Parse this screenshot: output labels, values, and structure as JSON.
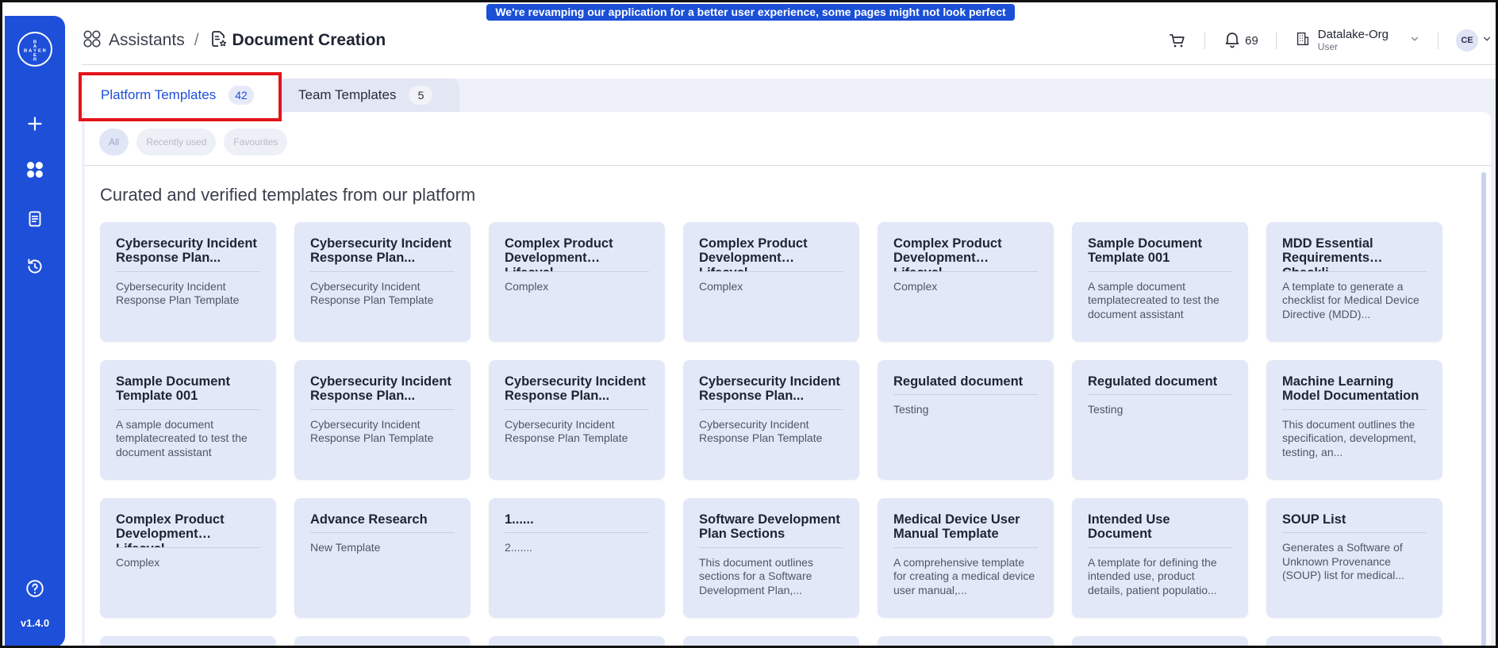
{
  "banner": {
    "text": "We're revamping our application for a better user experience, some pages might not look perfect yet!"
  },
  "sidebar": {
    "logo_text": "BAYER",
    "version": "v1.4.0"
  },
  "breadcrumb": {
    "root": "Assistants",
    "separator": "/",
    "current": "Document Creation"
  },
  "header": {
    "notification_count": "69",
    "org_name": "Datalake-Org",
    "org_role": "User",
    "avatar_initials": "CE"
  },
  "tabs": [
    {
      "label": "Platform Templates",
      "count": "42"
    },
    {
      "label": "Team Templates",
      "count": "5"
    }
  ],
  "filters": [
    "All",
    "Recently used",
    "Favourites"
  ],
  "section_title": "Curated and verified templates from our platform",
  "cards": [
    {
      "title": "Cybersecurity Incident Response Plan...",
      "desc": "Cybersecurity Incident Response Plan Template"
    },
    {
      "title": "Cybersecurity Incident Response Plan...",
      "desc": "Cybersecurity Incident Response Plan Template"
    },
    {
      "title": "Complex Product Development Lifecycl...",
      "desc": "Complex"
    },
    {
      "title": "Complex Product Development Lifecycl...",
      "desc": "Complex"
    },
    {
      "title": "Complex Product Development Lifecycl...",
      "desc": "Complex"
    },
    {
      "title": "Sample Document Template 001",
      "desc": "A sample document templatecreated to test the document assistant"
    },
    {
      "title": "MDD Essential Requirements Checkli...",
      "desc": "A template to generate a checklist for Medical Device Directive (MDD)..."
    },
    {
      "title": "Sample Document Template 001",
      "desc": "A sample document templatecreated to test the document assistant"
    },
    {
      "title": "Cybersecurity Incident Response Plan...",
      "desc": "Cybersecurity Incident Response Plan Template"
    },
    {
      "title": "Cybersecurity Incident Response Plan...",
      "desc": "Cybersecurity Incident Response Plan Template"
    },
    {
      "title": "Cybersecurity Incident Response Plan...",
      "desc": "Cybersecurity Incident Response Plan Template"
    },
    {
      "title": "Regulated document",
      "desc": "Testing"
    },
    {
      "title": "Regulated document",
      "desc": "Testing"
    },
    {
      "title": "Machine Learning Model Documentation",
      "desc": "This document outlines the specification, development, testing, an..."
    },
    {
      "title": "Complex Product Development Lifecycl...",
      "desc": "Complex"
    },
    {
      "title": "Advance Research",
      "desc": "New Template"
    },
    {
      "title": "1......",
      "desc": "2......."
    },
    {
      "title": "Software Development Plan Sections",
      "desc": "This document outlines sections for a Software Development Plan,..."
    },
    {
      "title": "Medical Device User Manual Template",
      "desc": "A comprehensive template for creating a medical device user manual,..."
    },
    {
      "title": "Intended Use Document",
      "desc": "A template for defining the intended use, product details, patient populatio..."
    },
    {
      "title": "SOUP List",
      "desc": "Generates a Software of Unknown Provenance (SOUP) list for medical..."
    }
  ]
}
